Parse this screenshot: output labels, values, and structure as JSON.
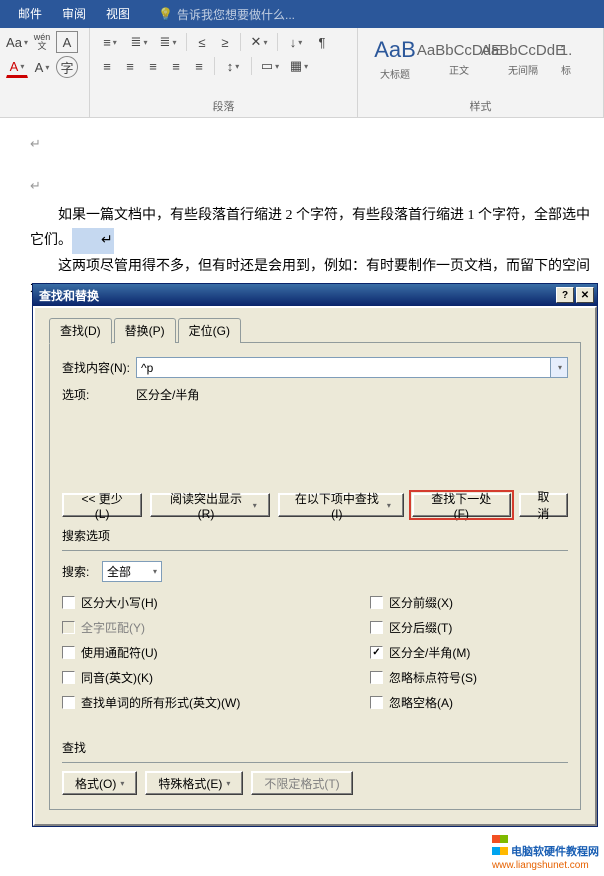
{
  "ribbon_tabs": {
    "mail": "邮件",
    "review": "审阅",
    "view": "视图",
    "help": "告诉我您想要做什么..."
  },
  "font_group": {
    "pinyin_text": "wén",
    "pinyin_char": "文"
  },
  "para_group": {
    "label": "段落"
  },
  "styles": {
    "label": "样式",
    "items": [
      {
        "preview": "AaB",
        "name": "大标题"
      },
      {
        "preview": "AaBbCcDdE",
        "name": "正文"
      },
      {
        "preview": "AaBbCcDdE",
        "name": "无间隔"
      },
      {
        "preview": "1.",
        "name": "标"
      }
    ]
  },
  "document": {
    "para1": "如果一篇文档中，有些段落首行缩进 2 个字符，有些段落首行缩进 1 个字符，全部选中它们。",
    "para2": "这两项尽管用得不多，但有时还是会用到，例如：有时要制作一页文档，而留下的空间不够"
  },
  "dialog": {
    "title": "查找和替换",
    "tabs": {
      "find": "查找(D)",
      "replace": "替换(P)",
      "goto": "定位(G)"
    },
    "find_label": "查找内容(N):",
    "find_value": "^p",
    "options_label": "选项:",
    "options_value": "区分全/半角",
    "buttons": {
      "less": "<< 更少(L)",
      "highlight": "阅读突出显示(R)",
      "find_in": "在以下项中查找(I)",
      "find_next": "查找下一处(F)",
      "cancel": "取消"
    },
    "search_options_label": "搜索选项",
    "search_label": "搜索:",
    "search_value": "全部",
    "checkboxes_left": [
      {
        "label": "区分大小写(H)",
        "checked": false,
        "disabled": false
      },
      {
        "label": "全字匹配(Y)",
        "checked": false,
        "disabled": true
      },
      {
        "label": "使用通配符(U)",
        "checked": false,
        "disabled": false
      },
      {
        "label": "同音(英文)(K)",
        "checked": false,
        "disabled": false
      },
      {
        "label": "查找单词的所有形式(英文)(W)",
        "checked": false,
        "disabled": false
      }
    ],
    "checkboxes_right": [
      {
        "label": "区分前缀(X)",
        "checked": false,
        "disabled": false
      },
      {
        "label": "区分后缀(T)",
        "checked": false,
        "disabled": false
      },
      {
        "label": "区分全/半角(M)",
        "checked": true,
        "disabled": false
      },
      {
        "label": "忽略标点符号(S)",
        "checked": false,
        "disabled": false
      },
      {
        "label": "忽略空格(A)",
        "checked": false,
        "disabled": false
      }
    ],
    "find_section": "查找",
    "bottom_buttons": {
      "format": "格式(O)",
      "special": "特殊格式(E)",
      "no_format": "不限定格式(T)"
    }
  },
  "watermark": {
    "line1": "电脑软硬件教程网",
    "line2": "www.liangshunet.com"
  }
}
